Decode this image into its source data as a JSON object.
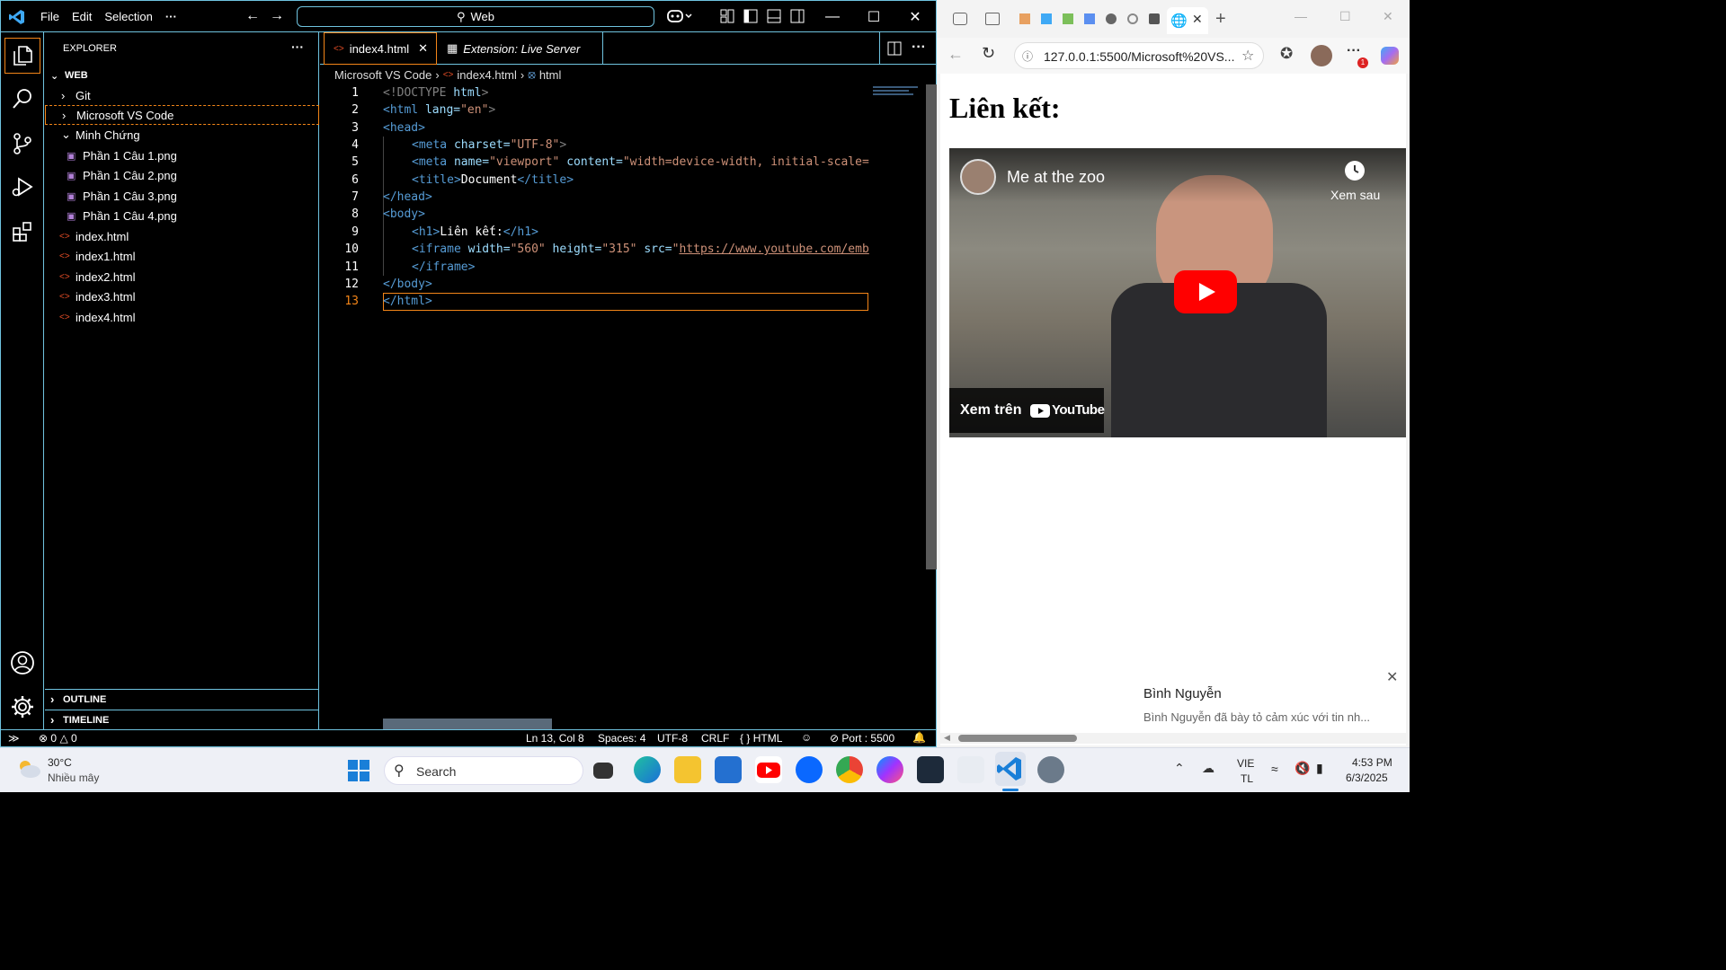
{
  "vscode": {
    "menu": [
      "File",
      "Edit",
      "Selection",
      "···"
    ],
    "command_center": "Web",
    "explorer_title": "EXPLORER",
    "explorer_more": "···",
    "workspace": "WEB",
    "tree": [
      {
        "label": "Git",
        "kind": "folder-closed"
      },
      {
        "label": "Microsoft VS Code",
        "kind": "folder-closed"
      },
      {
        "label": "Minh Chứng",
        "kind": "folder-open"
      },
      {
        "label": "Phần 1 Câu 1.png",
        "kind": "image"
      },
      {
        "label": "Phần 1 Câu 2.png",
        "kind": "image"
      },
      {
        "label": "Phần 1 Câu 3.png",
        "kind": "image"
      },
      {
        "label": "Phần 1 Câu 4.png",
        "kind": "image"
      },
      {
        "label": "index.html",
        "kind": "html"
      },
      {
        "label": "index1.html",
        "kind": "html"
      },
      {
        "label": "index2.html",
        "kind": "html"
      },
      {
        "label": "index3.html",
        "kind": "html"
      },
      {
        "label": "index4.html",
        "kind": "html"
      }
    ],
    "outline": "OUTLINE",
    "timeline": "TIMELINE",
    "tabs": [
      {
        "label": "index4.html",
        "active": true
      },
      {
        "label": "Extension: Live Server",
        "active": false
      }
    ],
    "breadcrumbs": [
      "Microsoft VS Code",
      "index4.html",
      "html"
    ],
    "code_lines": [
      "1",
      "2",
      "3",
      "4",
      "5",
      "6",
      "7",
      "8",
      "9",
      "10",
      "11",
      "12",
      "13"
    ],
    "code": {
      "l1": {
        "p1": "<!DOCTYPE",
        "p2": " html",
        "p3": ">"
      },
      "l2": {
        "p1": "<html",
        "p2": " lang=",
        "p3": "\"en\"",
        "p4": ">"
      },
      "l3": {
        "p1": "<head>"
      },
      "l4": {
        "p1": "<meta",
        "p2": " charset=",
        "p3": "\"UTF-8\"",
        "p4": ">"
      },
      "l5": {
        "p1": "<meta",
        "p2": " name=",
        "p3": "\"viewport\"",
        "p4": " content=",
        "p5": "\"width=device-width, initial-scale="
      },
      "l6": {
        "p1": "<title>",
        "p2": "Document",
        "p3": "</title>"
      },
      "l7": {
        "p1": "</head>"
      },
      "l8": {
        "p1": "<body>"
      },
      "l9": {
        "p1": "<h1>",
        "p2": "Liên kết:",
        "p3": "</h1>"
      },
      "l10": {
        "p1": "<iframe",
        "p2": " width=",
        "p3": "\"560\"",
        "p4": " height=",
        "p5": "\"315\"",
        "p6": " src=",
        "p7": "\"",
        "p8": "https://www.youtube.com/emb"
      },
      "l11": {
        "p1": "</iframe>"
      },
      "l12": {
        "p1": "</body>"
      },
      "l13": {
        "p1": "</html>"
      }
    },
    "status": {
      "errors": "0",
      "warnings": "0",
      "position": "Ln 13, Col 8",
      "spaces": "Spaces: 4",
      "encoding": "UTF-8",
      "eol": "CRLF",
      "language": "HTML",
      "language_braces": "{ }",
      "port": "Port : 5500"
    },
    "accent": "#6fc3df",
    "highlight": "#f38518"
  },
  "browser": {
    "url": "127.0.0.1:5500/Microsoft%20VS...",
    "heading": "Liên kết:",
    "video": {
      "title": "Me at the zoo",
      "watch_later": "Xem sau",
      "watch_on": "Xem trên",
      "youtube": "YouTube"
    },
    "notification": {
      "name": "Bình Nguyễn",
      "text": "Bình Nguyễn đã bày tỏ cảm xúc với tin nh..."
    }
  },
  "taskbar": {
    "weather_temp": "30°C",
    "weather_desc": "Nhiều mây",
    "search": "Search",
    "lang_top": "VIE",
    "lang_bottom": "TL",
    "time": "4:53 PM",
    "date": "6/3/2025"
  }
}
